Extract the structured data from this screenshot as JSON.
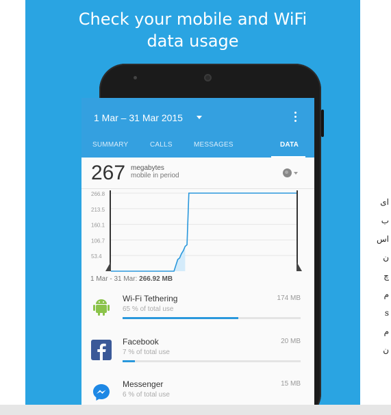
{
  "promo": {
    "title_line1": "Check your mobile and WiFi",
    "title_line2": "data usage"
  },
  "appbar": {
    "date_range": "1 Mar – 31 Mar 2015",
    "dropdown_icon": "caret-down-icon",
    "menu_icon": "more-vert-icon"
  },
  "tabs": [
    {
      "label": "SUMMARY"
    },
    {
      "label": "CALLS"
    },
    {
      "label": "MESSAGES"
    },
    {
      "label": "DATA",
      "active": true
    }
  ],
  "summary": {
    "value": "267",
    "unit": "megabytes",
    "subtitle": "mobile in period",
    "network_icon": "globe-icon"
  },
  "chart_data": {
    "type": "area",
    "yticks": [
      "266.8",
      "213.5",
      "160.1",
      "106.7",
      "53.4"
    ],
    "ylim": [
      0,
      266.8
    ],
    "x": [
      0.0,
      0.34,
      0.35,
      0.36,
      0.37,
      0.38,
      0.39,
      0.4,
      0.41,
      0.42,
      1.0
    ],
    "y": [
      0,
      0,
      20,
      40,
      45,
      60,
      70,
      85,
      90,
      266.8,
      266.8
    ],
    "period_label": "1 Mar - 31 Mar:",
    "period_total": "266.92 MB"
  },
  "apps": [
    {
      "name": "Wi-Fi Tethering",
      "size": "174 MB",
      "pct_label": "65 % of total use",
      "fraction": 0.65,
      "icon": "android-icon",
      "color": "#8bc34a"
    },
    {
      "name": "Facebook",
      "size": "20 MB",
      "pct_label": "7 % of total use",
      "fraction": 0.07,
      "icon": "facebook-icon",
      "color": "#3b5998"
    },
    {
      "name": "Messenger",
      "size": "15 MB",
      "pct_label": "6 % of total use",
      "fraction": 0.06,
      "icon": "messenger-icon",
      "color": "#1e88e5"
    }
  ],
  "side_text": [
    "ای",
    "ب",
    "اس",
    "ن",
    "چ",
    "م",
    "s",
    "م",
    "ن"
  ]
}
